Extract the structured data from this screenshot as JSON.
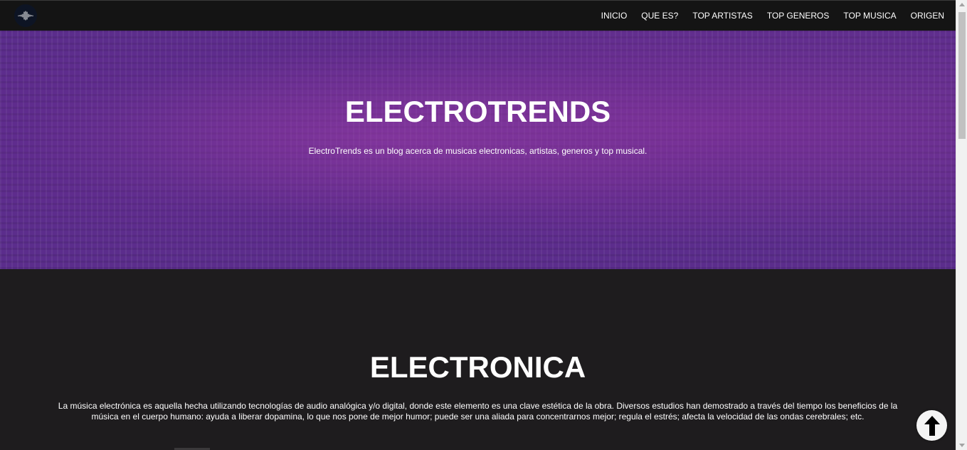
{
  "nav": {
    "logo_icon": "soundwave-icon",
    "links": [
      "INICIO",
      "QUE ES?",
      "TOP ARTISTAS",
      "TOP GENEROS",
      "TOP MUSICA",
      "ORIGEN"
    ]
  },
  "hero": {
    "title": "ELECTROTRENDS",
    "subtitle": "ElectroTrends es un blog acerca de musicas electronicas, artistas, generos y top musical."
  },
  "section": {
    "title": "ELECTRONICA",
    "body": "La música electrónica es aquella hecha utilizando tecnologías de audio analógica y/o digital, donde este elemento es una clave estética de la obra. Diversos estudios han demostrado a través del tiempo los beneficios de la música en el cuerpo humano: ayuda a liberar dopamina, lo que nos pone de mejor humor; puede ser una aliada para concentrarnos mejor; regula el estrés; afecta la velocidad de las ondas cerebrales; etc."
  },
  "back_to_top": {
    "icon": "arrow-up-icon"
  },
  "colors": {
    "navbar_bg": "#141414",
    "hero_bg": "#5b2d8c",
    "section_bg": "#1e1c1e",
    "text": "#ffffff"
  }
}
